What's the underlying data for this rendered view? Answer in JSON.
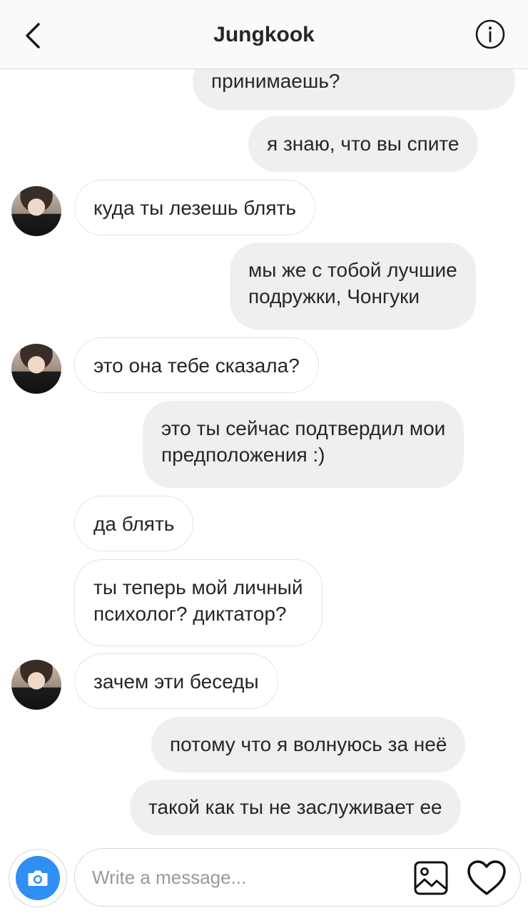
{
  "header": {
    "title": "Jungkook",
    "back_icon": "chevron-left-icon",
    "info_icon": "info-icon"
  },
  "messages": [
    {
      "side": "out",
      "text": "принимаешь?"
    },
    {
      "side": "out",
      "text": "я знаю, что вы спите"
    },
    {
      "side": "in",
      "text": "куда ты лезешь блять",
      "avatar": true
    },
    {
      "side": "out",
      "text": "мы же с тобой лучшие\nподружки, Чонгуки"
    },
    {
      "side": "in",
      "text": "это она тебе сказала?",
      "avatar": true
    },
    {
      "side": "out",
      "text": "это ты сейчас подтвердил мои\nпредположения :)"
    },
    {
      "side": "in",
      "text": "да блять",
      "avatar": false
    },
    {
      "side": "in",
      "text": "ты теперь мой личный\nпсихолог? диктатор?",
      "avatar": false
    },
    {
      "side": "in",
      "text": "зачем эти беседы",
      "avatar": true
    },
    {
      "side": "out",
      "text": "потому что я волнуюсь за неё"
    },
    {
      "side": "out",
      "text": "такой как ты не заслуживает ее"
    }
  ],
  "composer": {
    "placeholder": "Write a message...",
    "camera_icon": "camera-icon",
    "gallery_icon": "image-icon",
    "like_icon": "heart-icon"
  },
  "colors": {
    "outgoing_bubble": "#efefef",
    "incoming_border": "#e3e3e3",
    "camera_accent": "#2f8ff2"
  }
}
